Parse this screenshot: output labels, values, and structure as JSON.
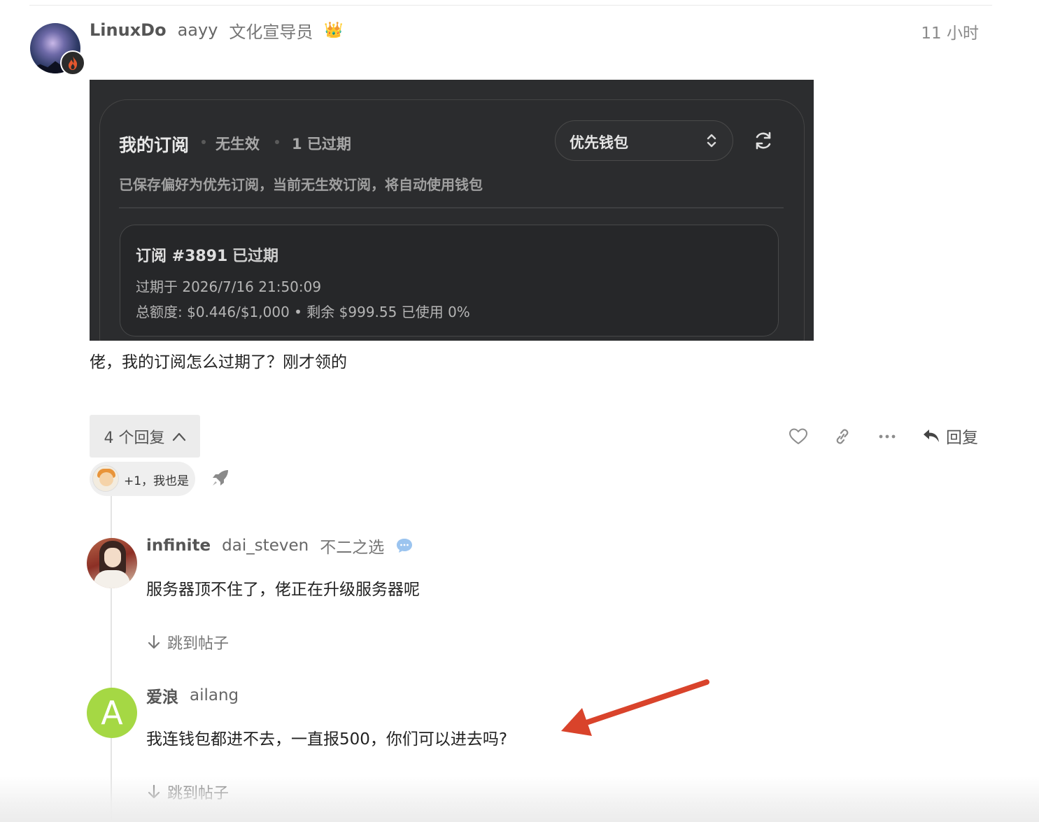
{
  "post": {
    "username": "LinuxDo",
    "handle": "aayy",
    "user_title": "文化宣导员",
    "badge_glyph": "👑",
    "timestamp": "11 小时",
    "text": "佬，我的订阅怎么过期了？刚才领的",
    "avatar_icon": "galaxy-avatar",
    "flair_icon": "flame-icon"
  },
  "screenshot": {
    "title": "我的订阅",
    "meta_active": "无生效",
    "meta_expired": "1 已过期",
    "select_value": "优先钱包",
    "note": "已保存偏好为优先订阅，当前无生效订阅，将自动使用钱包",
    "subscription": {
      "id": "订阅 #3891",
      "status": "已过期",
      "expiry": "过期于 2026/7/16 21:50:09",
      "quota": "总额度: $0.446/$1,000 • 剩余 $999.55 已使用 0%"
    }
  },
  "actions": {
    "replies_toggle": "4 个回复",
    "reply_label": "回复",
    "icons": [
      "heart-icon",
      "link-icon",
      "more-icon",
      "reply-icon"
    ]
  },
  "reaction": {
    "text": "+1，我也是",
    "boost_icon": "rocket-icon"
  },
  "replies": [
    {
      "username": "infinite",
      "handle": "dai_steven",
      "user_title": "不二之选",
      "text": "服务器顶不住了，佬正在升级服务器呢",
      "jump_label": "跳到帖子"
    },
    {
      "username": "爱浪",
      "handle": "ailang",
      "avatar_letter": "A",
      "text": "我连钱包都进不去，一直报500，你们可以进去吗?",
      "jump_label": "跳到帖子"
    }
  ],
  "colors": {
    "annotation_arrow": "#d9432b",
    "letter_avatar": "#a5d844",
    "screenshot_bg": "#2c2d2f"
  }
}
